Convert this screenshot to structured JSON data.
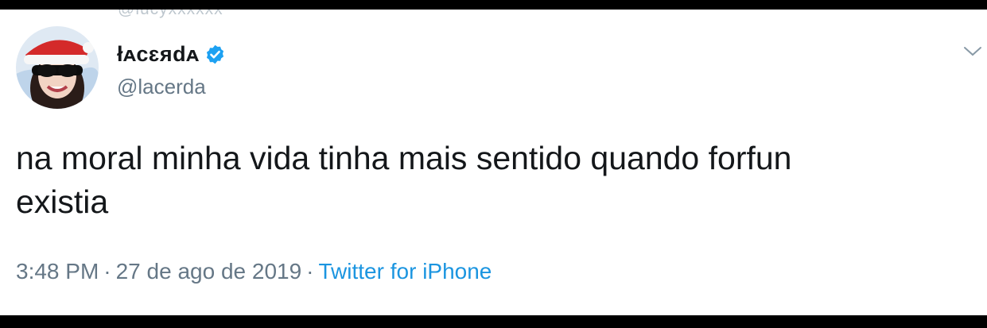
{
  "tweet": {
    "cropped_above_text": "@lucyxxxxxx",
    "author": {
      "display_name": "łᴀcɛᴙdᴀ",
      "handle": "@lacerda",
      "verified": true,
      "avatar_icon": "avatar-santa-hat-sunglasses"
    },
    "text": "na moral minha vida tinha mais sentido quando forfun\nexistia",
    "time": "3:48 PM",
    "date": "27 de ago de 2019",
    "separator": "·",
    "source": "Twitter for iPhone",
    "menu_icon": "chevron-down-icon"
  },
  "colors": {
    "text_primary": "#14171a",
    "text_secondary": "#657786",
    "link": "#1b95e0",
    "verified_badge": "#1da1f2",
    "background": "#ffffff",
    "frame": "#000000"
  }
}
